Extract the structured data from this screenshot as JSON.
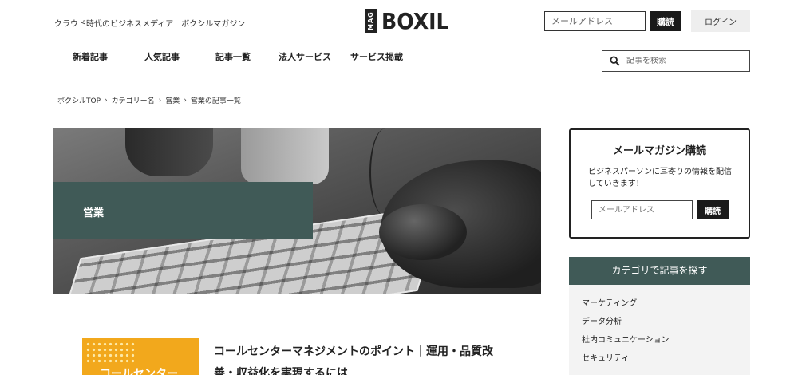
{
  "header": {
    "tagline": "クラウド時代のビジネスメディア　ボクシルマガジン",
    "logo_mag": "MAG",
    "logo_brand": "BOXIL",
    "email_placeholder": "メールアドレス",
    "subscribe_label": "購読",
    "login_label": "ログイン"
  },
  "nav": {
    "items": [
      {
        "label": "新着記事"
      },
      {
        "label": "人気記事"
      },
      {
        "label": "記事一覧"
      },
      {
        "label": "法人サービス"
      },
      {
        "label": "サービス掲載"
      }
    ],
    "search_placeholder": "記事を検索"
  },
  "breadcrumb": {
    "items": [
      "ボクシルTOP",
      "カテゴリー名",
      "営業",
      "営業の記事一覧"
    ]
  },
  "hero": {
    "label": "営業"
  },
  "article": {
    "thumb_text": "コールセンター",
    "title": "コールセンターマネジメントのポイント｜運用・品質改善・収益化を実現するには"
  },
  "sidebar": {
    "newsletter": {
      "title": "メールマガジン購読",
      "description": "ビジネスパーソンに耳寄りの情報を配信していきます！",
      "email_placeholder": "メールアドレス",
      "subscribe_label": "購読"
    },
    "categories": {
      "heading": "カテゴリで記事を探す",
      "items": [
        "マーケティング",
        "データ分析",
        "社内コミュニケーション",
        "セキュリティ"
      ]
    }
  },
  "colors": {
    "accent": "#405a57",
    "dark": "#1a1a1a",
    "panel_bg": "#f3f3f3"
  }
}
